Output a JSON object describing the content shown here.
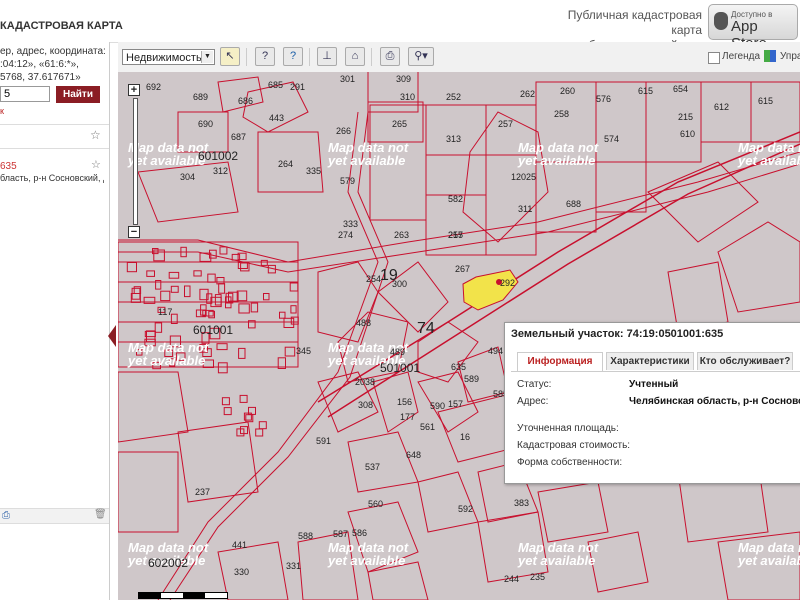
{
  "header": {
    "logo_text": "КАДАСТРОВАЯ КАРТА",
    "promo_line1": "Публичная кадастровая карта",
    "promo_line2": "на мобильном устройстве",
    "appstore_small": "Доступно в",
    "appstore_big": "App Store"
  },
  "sidebar": {
    "hint_line1": "ер, адрес, координата:",
    "hint_line2": ":04:12», «61:6:*»,",
    "hint_line3": "5768, 37.617671»",
    "search_value": "5",
    "find_button": "Найти",
    "link": "к",
    "result_number": "635",
    "result_address": "бласть, р-н Сосновский, д"
  },
  "toolbar": {
    "layer_select": "Недвижимость",
    "legend_label": "Легенда",
    "manage_label": "Упра"
  },
  "map": {
    "watermark": "Map data not yet available",
    "quarters": [
      "601002",
      "601001",
      "501001",
      "602002"
    ],
    "labels": [
      "692",
      "689",
      "686",
      "690",
      "687",
      "685",
      "291",
      "301",
      "309",
      "310",
      "252",
      "262",
      "260",
      "576",
      "615",
      "654",
      "615",
      "612",
      "266",
      "265",
      "313",
      "257",
      "258",
      "574",
      "215",
      "610",
      "264",
      "312",
      "304",
      "579",
      "12025",
      "688",
      "582",
      "255",
      "311",
      "274",
      "263",
      "217",
      "267",
      "254",
      "300",
      "292",
      "117",
      "488",
      "489",
      "635",
      "2038",
      "308",
      "177",
      "561",
      "156",
      "157",
      "590",
      "589",
      "585",
      "16",
      "591",
      "648",
      "537",
      "560",
      "592",
      "383",
      "586",
      "587",
      "588",
      "330",
      "331",
      "244",
      "235",
      "345",
      "494",
      "237",
      "441",
      "443",
      "335",
      "333",
      "19",
      "74"
    ]
  },
  "popup": {
    "title": "Земельный участок: 74:19:0501001:635",
    "tabs": [
      "Информация",
      "Характеристики",
      "Кто обслуживает?"
    ],
    "rows": [
      {
        "label": "Статус:",
        "value": "Учтенный"
      },
      {
        "label": "Адрес:",
        "value": "Челябинская область, р-н Сосновский"
      },
      {
        "label": "Уточненная площадь:",
        "value": ""
      },
      {
        "label": "Кадастровая стоимость:",
        "value": ""
      },
      {
        "label": "Форма собственности:",
        "value": ""
      }
    ]
  },
  "colors": {
    "accent": "#8b1d24",
    "map_bg": "#cfc7c9",
    "parcel_line": "#c8102e",
    "selected_parcel": "#f2e34a"
  }
}
